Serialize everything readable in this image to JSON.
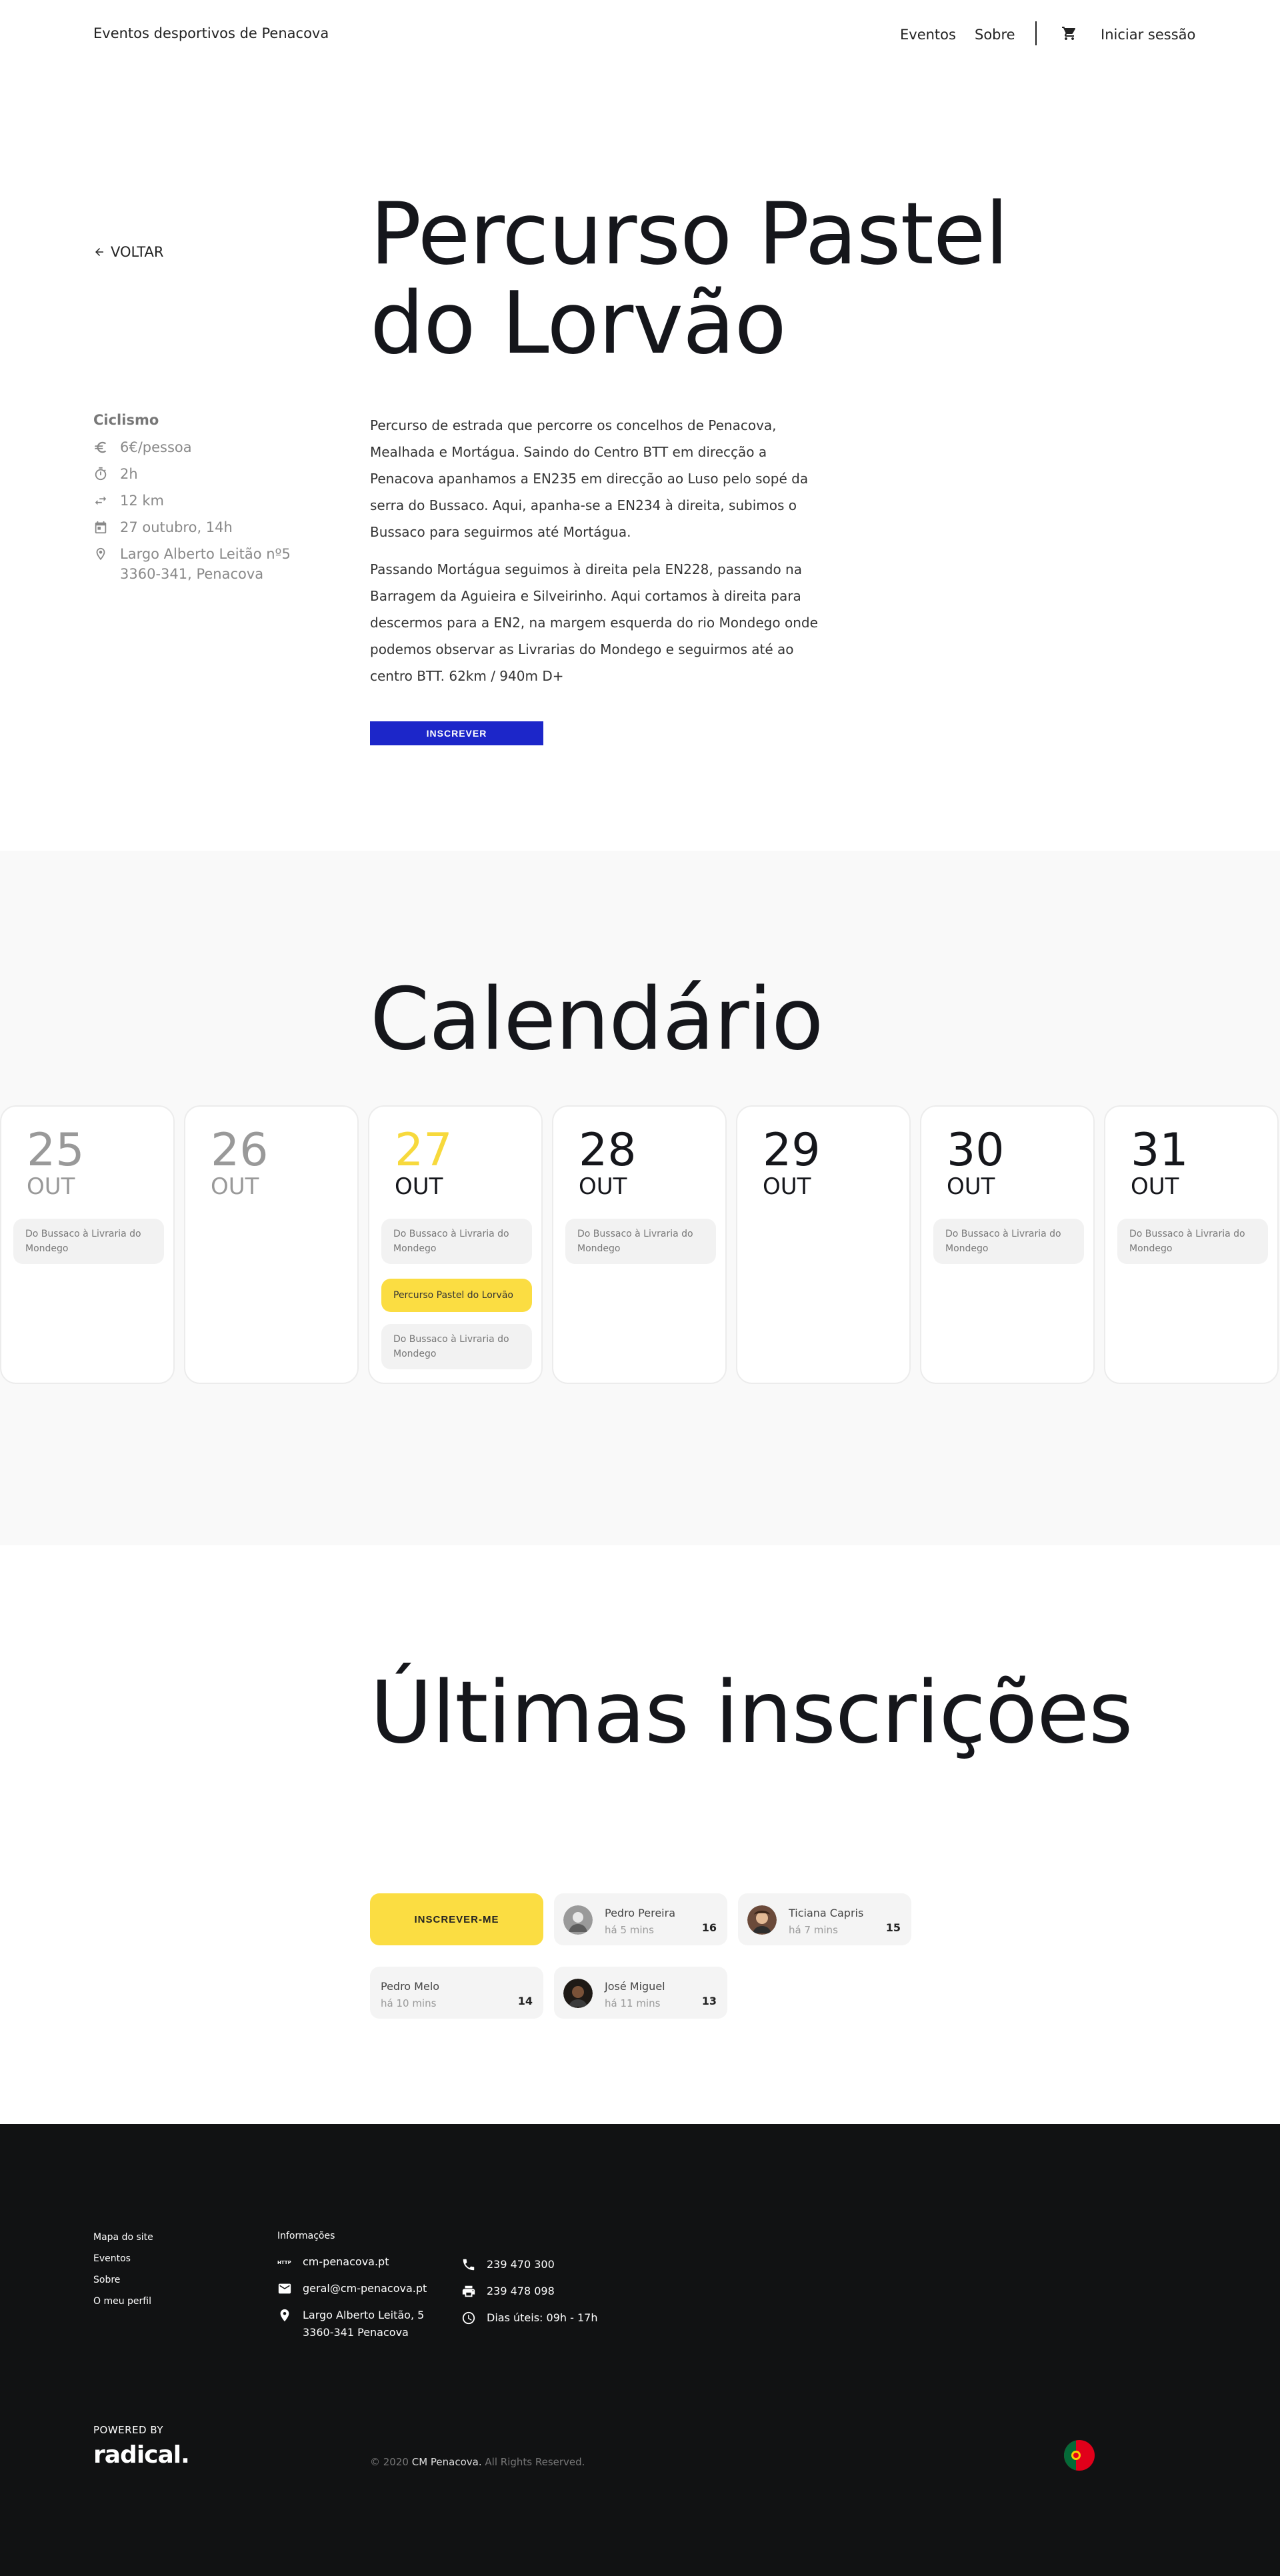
{
  "header": {
    "site_title": "Eventos desportivos de Penacova",
    "nav": {
      "events": "Eventos",
      "about": "Sobre",
      "login": "Iniciar sessão"
    }
  },
  "event": {
    "back": "VOLTAR",
    "title_line1": "Percurso Pastel",
    "title_line2": "do Lorvão",
    "category": "Ciclismo",
    "price": "6€/pessoa",
    "duration": "2h",
    "distance": "12 km",
    "date": "27 outubro, 14h",
    "address_line1": "Largo Alberto Leitão nº5",
    "address_line2": "3360-341, Penacova",
    "description_p1": "Percurso de estrada que percorre os concelhos de Penacova, Mealhada e Mortágua. Saindo do Centro BTT em direcção a Penacova apanhamos a EN235 em direcção ao Luso pelo sopé da serra do Bussaco. Aqui, apanha-se a EN234 à direita, subimos o Bussaco para seguirmos até Mortágua.",
    "description_p2": "Passando Mortágua seguimos à direita pela EN228, passando na Barragem da Aguieira e Silveirinho. Aqui cortamos à direita para descermos para a EN2, na margem esquerda do rio Mondego onde podemos observar as Livrarias do Mondego e seguirmos até ao centro BTT. 62km / 940m D+",
    "signup_label": "INSCREVER"
  },
  "calendar": {
    "title": "Calendário",
    "days": [
      {
        "num": "25",
        "month": "OUT",
        "events": [
          "Do Bussaco à Livraria do Mondego"
        ]
      },
      {
        "num": "26",
        "month": "OUT",
        "events": []
      },
      {
        "num": "27",
        "month": "OUT",
        "events": [
          "Do Bussaco à Livraria do Mondego",
          "Percurso Pastel do Lorvão",
          "Do Bussaco à Livraria do Mondego"
        ]
      },
      {
        "num": "28",
        "month": "OUT",
        "events": [
          "Do Bussaco à Livraria do Mondego"
        ]
      },
      {
        "num": "29",
        "month": "OUT",
        "events": []
      },
      {
        "num": "30",
        "month": "OUT",
        "events": [
          "Do Bussaco à Livraria do Mondego"
        ]
      },
      {
        "num": "31",
        "month": "OUT",
        "events": [
          "Do Bussaco à Livraria do Mondego"
        ]
      }
    ]
  },
  "latest": {
    "title": "Últimas inscrições",
    "join_label": "INSCREVER-ME",
    "entries": [
      {
        "name": "Pedro Pereira",
        "time": "há 5 mins",
        "count": "16"
      },
      {
        "name": "Ticiana Capris",
        "time": "há 7 mins",
        "count": "15"
      },
      {
        "name": "Pedro Melo",
        "time": "há 10 mins",
        "count": "14"
      },
      {
        "name": "José Miguel",
        "time": "há 11 mins",
        "count": "13"
      }
    ]
  },
  "footer": {
    "sitemap_title": "Mapa do site",
    "links": [
      "Eventos",
      "Sobre",
      "O meu perfil"
    ],
    "info_title": "Informações",
    "website": "cm-penacova.pt",
    "email": "geral@cm-penacova.pt",
    "address_line1": "Largo Alberto Leitão, 5",
    "address_line2": "3360-341 Penacova",
    "phone": "239 470 300",
    "fax": "239 478 098",
    "hours": "Dias úteis: 09h - 17h",
    "powered_by": "POWERED BY",
    "brand": "radical.",
    "copyright_prefix": "© 2020",
    "copyright_org": "CM Penacova.",
    "copyright_suffix": "All Rights Reserved."
  },
  "colors": {
    "accent_yellow": "#fbdd42",
    "accent_blue": "#1c26c9",
    "footer_bg": "#111213"
  }
}
